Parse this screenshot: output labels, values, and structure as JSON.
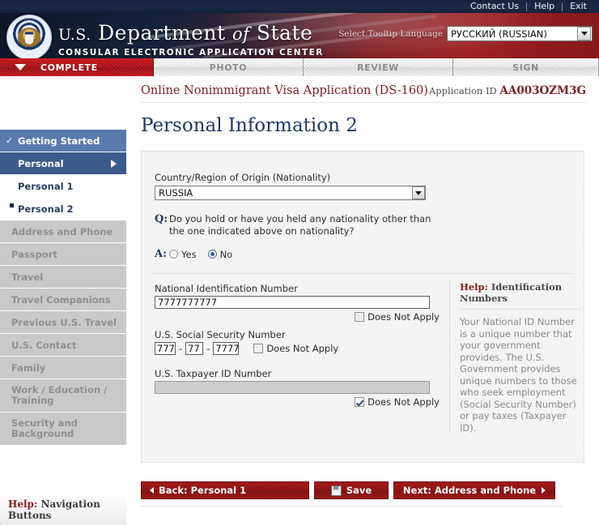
{
  "topbar": {
    "links": [
      "Contact Us",
      "Help",
      "Exit"
    ]
  },
  "masthead": {
    "title_us": "U.S.",
    "title_department": "Department",
    "title_of": "of",
    "title_state": "State",
    "subtitle": "CONSULAR ELECTRONIC APPLICATION CENTER",
    "language_label": "Select Tooltip Language",
    "language_value": "РУССКИЙ (RUSSIAN)"
  },
  "tabs": [
    {
      "label": "COMPLETE",
      "active": true
    },
    {
      "label": "PHOTO",
      "active": false
    },
    {
      "label": "REVIEW",
      "active": false
    },
    {
      "label": "SIGN",
      "active": false
    }
  ],
  "sidebar": {
    "items": [
      {
        "label": "Getting Started",
        "state": "done"
      },
      {
        "label": "Personal",
        "state": "current"
      },
      {
        "label": "Personal 1",
        "state": "sub"
      },
      {
        "label": "Personal 2",
        "state": "sub-selected"
      },
      {
        "label": "Address and Phone",
        "state": "disabled"
      },
      {
        "label": "Passport",
        "state": "disabled"
      },
      {
        "label": "Travel",
        "state": "disabled"
      },
      {
        "label": "Travel Companions",
        "state": "disabled"
      },
      {
        "label": "Previous U.S. Travel",
        "state": "disabled"
      },
      {
        "label": "U.S. Contact",
        "state": "disabled"
      },
      {
        "label": "Family",
        "state": "disabled"
      },
      {
        "label": "Work / Education /|Training",
        "state": "disabled"
      },
      {
        "label": "Security and|Background",
        "state": "disabled"
      }
    ],
    "help_nav_prefix": "Help:",
    "help_nav_label": " Navigation Buttons"
  },
  "header": {
    "app_title": "Online Nonimmigrant Visa Application (DS-160)",
    "application_id_label": "Application ID ",
    "application_id_value": "AA003OZM3G",
    "page_title": "Personal Information 2"
  },
  "form": {
    "country_label": "Country/Region of Origin (Nationality)",
    "country_value": "RUSSIA",
    "q_marker": "Q:",
    "question": "Do you hold or have you held any nationality other than the one indicated above on nationality?",
    "a_marker": "A:",
    "radio_yes": "Yes",
    "radio_no": "No",
    "radio_selected": "No",
    "national_id_label": "National Identification Number",
    "national_id_value": "7777777777",
    "national_id_dna_label": "Does Not Apply",
    "national_id_dna_checked": false,
    "ssn_label": "U.S. Social Security Number",
    "ssn_part1": "777",
    "ssn_part2": "77",
    "ssn_part3": "7777",
    "ssn_dash": "-",
    "ssn_dna_label": "Does Not Apply",
    "ssn_dna_checked": false,
    "taxpayer_label": "U.S. Taxpayer ID Number",
    "taxpayer_value": "",
    "taxpayer_dna_label": "Does Not Apply",
    "taxpayer_dna_checked": true
  },
  "help": {
    "head_prefix": "Help:",
    "head_label": " Identification Numbers",
    "body": "Your National ID Number is a unique number that your government provides. The U.S. Government provides unique numbers to those who seek employment (Social Security Number) or pay taxes (Taxpayer ID)."
  },
  "buttons": {
    "back": "Back: Personal 1",
    "save": "Save",
    "next": "Next: Address and Phone"
  },
  "colors": {
    "brand_red": "#9d2024",
    "brand_navy": "#1f3864",
    "nav_done": "#5a7aae",
    "nav_current": "#3c5a8c",
    "nav_disabled": "#c9c9c9",
    "panel_bg": "#f4f4f4",
    "help_red": "#8c1b1b"
  }
}
